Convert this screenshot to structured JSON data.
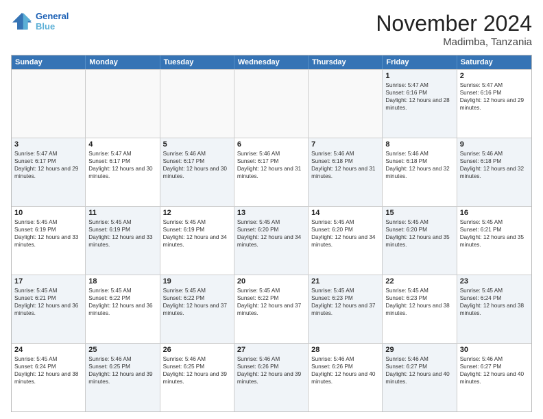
{
  "header": {
    "logo_line1": "General",
    "logo_line2": "Blue",
    "month_title": "November 2024",
    "location": "Madimba, Tanzania"
  },
  "weekdays": [
    "Sunday",
    "Monday",
    "Tuesday",
    "Wednesday",
    "Thursday",
    "Friday",
    "Saturday"
  ],
  "rows": [
    [
      {
        "day": "",
        "info": "",
        "shaded": false,
        "empty": true
      },
      {
        "day": "",
        "info": "",
        "shaded": false,
        "empty": true
      },
      {
        "day": "",
        "info": "",
        "shaded": false,
        "empty": true
      },
      {
        "day": "",
        "info": "",
        "shaded": false,
        "empty": true
      },
      {
        "day": "",
        "info": "",
        "shaded": false,
        "empty": true
      },
      {
        "day": "1",
        "sunrise": "Sunrise: 5:47 AM",
        "sunset": "Sunset: 6:16 PM",
        "daylight": "Daylight: 12 hours and 28 minutes.",
        "shaded": true
      },
      {
        "day": "2",
        "sunrise": "Sunrise: 5:47 AM",
        "sunset": "Sunset: 6:16 PM",
        "daylight": "Daylight: 12 hours and 29 minutes.",
        "shaded": false
      }
    ],
    [
      {
        "day": "3",
        "sunrise": "Sunrise: 5:47 AM",
        "sunset": "Sunset: 6:17 PM",
        "daylight": "Daylight: 12 hours and 29 minutes.",
        "shaded": true
      },
      {
        "day": "4",
        "sunrise": "Sunrise: 5:47 AM",
        "sunset": "Sunset: 6:17 PM",
        "daylight": "Daylight: 12 hours and 30 minutes.",
        "shaded": false
      },
      {
        "day": "5",
        "sunrise": "Sunrise: 5:46 AM",
        "sunset": "Sunset: 6:17 PM",
        "daylight": "Daylight: 12 hours and 30 minutes.",
        "shaded": true
      },
      {
        "day": "6",
        "sunrise": "Sunrise: 5:46 AM",
        "sunset": "Sunset: 6:17 PM",
        "daylight": "Daylight: 12 hours and 31 minutes.",
        "shaded": false
      },
      {
        "day": "7",
        "sunrise": "Sunrise: 5:46 AM",
        "sunset": "Sunset: 6:18 PM",
        "daylight": "Daylight: 12 hours and 31 minutes.",
        "shaded": true
      },
      {
        "day": "8",
        "sunrise": "Sunrise: 5:46 AM",
        "sunset": "Sunset: 6:18 PM",
        "daylight": "Daylight: 12 hours and 32 minutes.",
        "shaded": false
      },
      {
        "day": "9",
        "sunrise": "Sunrise: 5:46 AM",
        "sunset": "Sunset: 6:18 PM",
        "daylight": "Daylight: 12 hours and 32 minutes.",
        "shaded": true
      }
    ],
    [
      {
        "day": "10",
        "sunrise": "Sunrise: 5:45 AM",
        "sunset": "Sunset: 6:19 PM",
        "daylight": "Daylight: 12 hours and 33 minutes.",
        "shaded": false
      },
      {
        "day": "11",
        "sunrise": "Sunrise: 5:45 AM",
        "sunset": "Sunset: 6:19 PM",
        "daylight": "Daylight: 12 hours and 33 minutes.",
        "shaded": true
      },
      {
        "day": "12",
        "sunrise": "Sunrise: 5:45 AM",
        "sunset": "Sunset: 6:19 PM",
        "daylight": "Daylight: 12 hours and 34 minutes.",
        "shaded": false
      },
      {
        "day": "13",
        "sunrise": "Sunrise: 5:45 AM",
        "sunset": "Sunset: 6:20 PM",
        "daylight": "Daylight: 12 hours and 34 minutes.",
        "shaded": true
      },
      {
        "day": "14",
        "sunrise": "Sunrise: 5:45 AM",
        "sunset": "Sunset: 6:20 PM",
        "daylight": "Daylight: 12 hours and 34 minutes.",
        "shaded": false
      },
      {
        "day": "15",
        "sunrise": "Sunrise: 5:45 AM",
        "sunset": "Sunset: 6:20 PM",
        "daylight": "Daylight: 12 hours and 35 minutes.",
        "shaded": true
      },
      {
        "day": "16",
        "sunrise": "Sunrise: 5:45 AM",
        "sunset": "Sunset: 6:21 PM",
        "daylight": "Daylight: 12 hours and 35 minutes.",
        "shaded": false
      }
    ],
    [
      {
        "day": "17",
        "sunrise": "Sunrise: 5:45 AM",
        "sunset": "Sunset: 6:21 PM",
        "daylight": "Daylight: 12 hours and 36 minutes.",
        "shaded": true
      },
      {
        "day": "18",
        "sunrise": "Sunrise: 5:45 AM",
        "sunset": "Sunset: 6:22 PM",
        "daylight": "Daylight: 12 hours and 36 minutes.",
        "shaded": false
      },
      {
        "day": "19",
        "sunrise": "Sunrise: 5:45 AM",
        "sunset": "Sunset: 6:22 PM",
        "daylight": "Daylight: 12 hours and 37 minutes.",
        "shaded": true
      },
      {
        "day": "20",
        "sunrise": "Sunrise: 5:45 AM",
        "sunset": "Sunset: 6:22 PM",
        "daylight": "Daylight: 12 hours and 37 minutes.",
        "shaded": false
      },
      {
        "day": "21",
        "sunrise": "Sunrise: 5:45 AM",
        "sunset": "Sunset: 6:23 PM",
        "daylight": "Daylight: 12 hours and 37 minutes.",
        "shaded": true
      },
      {
        "day": "22",
        "sunrise": "Sunrise: 5:45 AM",
        "sunset": "Sunset: 6:23 PM",
        "daylight": "Daylight: 12 hours and 38 minutes.",
        "shaded": false
      },
      {
        "day": "23",
        "sunrise": "Sunrise: 5:45 AM",
        "sunset": "Sunset: 6:24 PM",
        "daylight": "Daylight: 12 hours and 38 minutes.",
        "shaded": true
      }
    ],
    [
      {
        "day": "24",
        "sunrise": "Sunrise: 5:45 AM",
        "sunset": "Sunset: 6:24 PM",
        "daylight": "Daylight: 12 hours and 38 minutes.",
        "shaded": false
      },
      {
        "day": "25",
        "sunrise": "Sunrise: 5:46 AM",
        "sunset": "Sunset: 6:25 PM",
        "daylight": "Daylight: 12 hours and 39 minutes.",
        "shaded": true
      },
      {
        "day": "26",
        "sunrise": "Sunrise: 5:46 AM",
        "sunset": "Sunset: 6:25 PM",
        "daylight": "Daylight: 12 hours and 39 minutes.",
        "shaded": false
      },
      {
        "day": "27",
        "sunrise": "Sunrise: 5:46 AM",
        "sunset": "Sunset: 6:26 PM",
        "daylight": "Daylight: 12 hours and 39 minutes.",
        "shaded": true
      },
      {
        "day": "28",
        "sunrise": "Sunrise: 5:46 AM",
        "sunset": "Sunset: 6:26 PM",
        "daylight": "Daylight: 12 hours and 40 minutes.",
        "shaded": false
      },
      {
        "day": "29",
        "sunrise": "Sunrise: 5:46 AM",
        "sunset": "Sunset: 6:27 PM",
        "daylight": "Daylight: 12 hours and 40 minutes.",
        "shaded": true
      },
      {
        "day": "30",
        "sunrise": "Sunrise: 5:46 AM",
        "sunset": "Sunset: 6:27 PM",
        "daylight": "Daylight: 12 hours and 40 minutes.",
        "shaded": false
      }
    ]
  ]
}
